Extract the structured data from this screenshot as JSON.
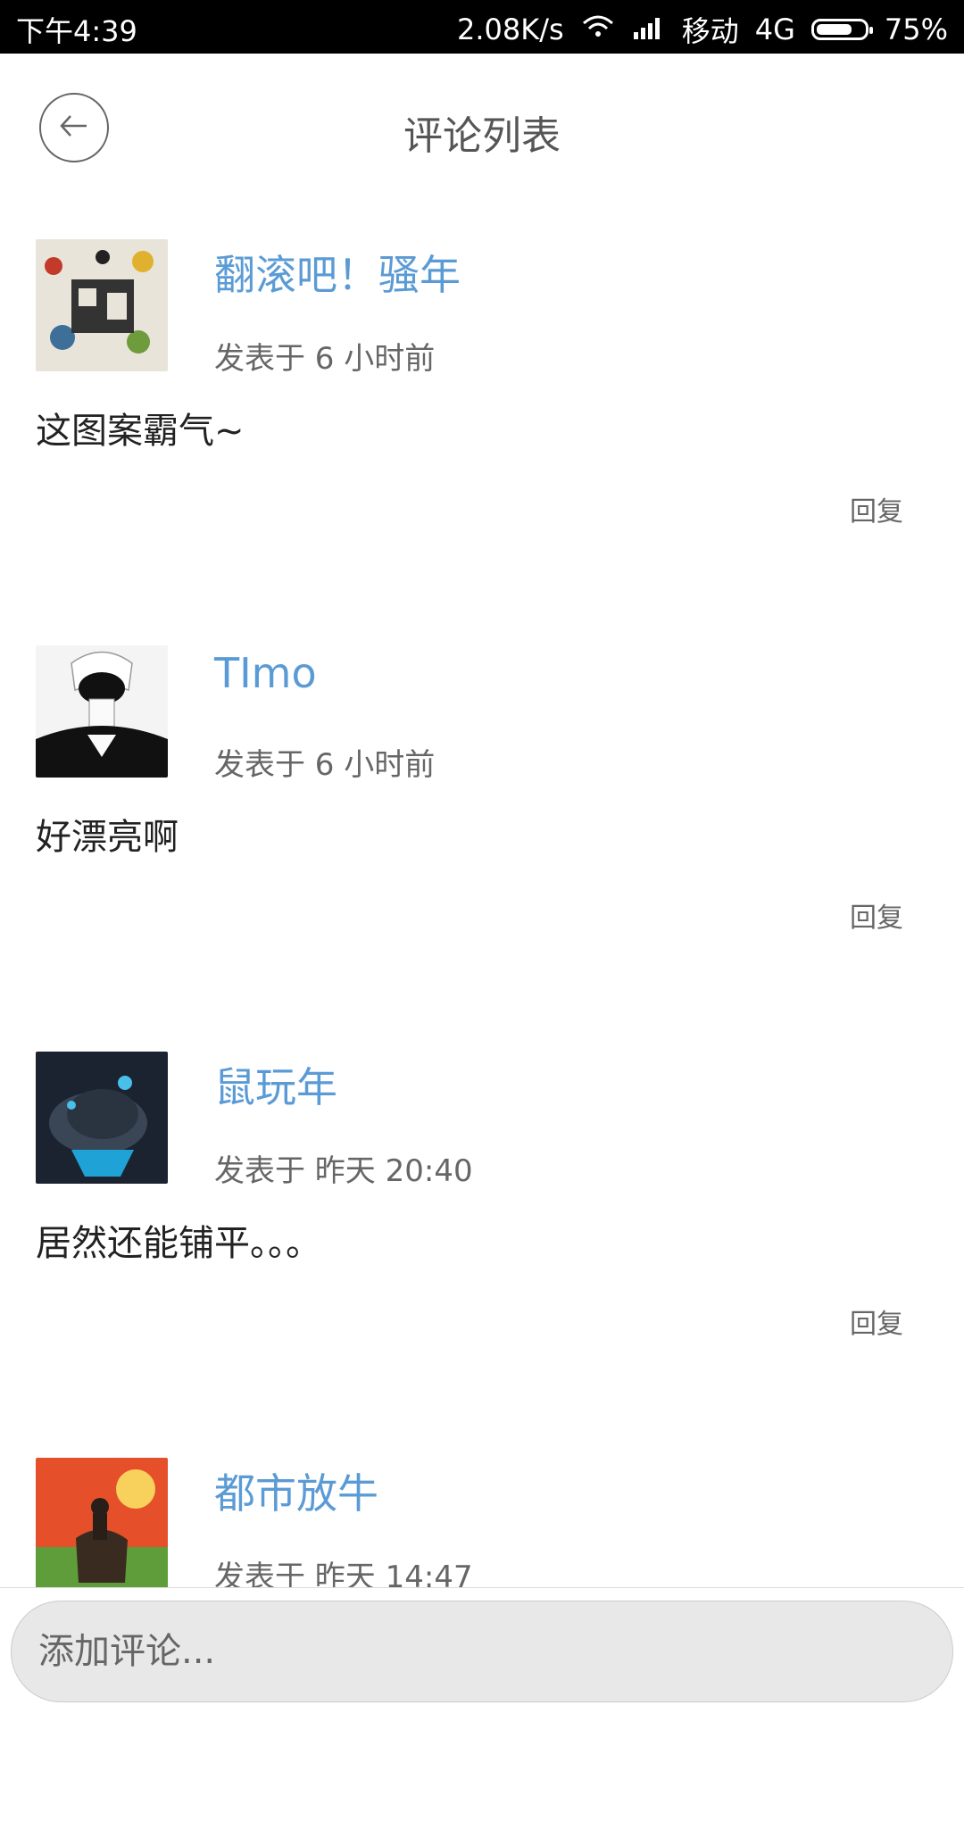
{
  "status_bar": {
    "time": "下午4:39",
    "speed": "2.08K/s",
    "carrier": "移动",
    "network": "4G",
    "battery": "75%",
    "battery_level": 0.75
  },
  "header": {
    "title": "评论列表"
  },
  "comments": [
    {
      "name": "翻滚吧！骚年",
      "meta": "发表于 6 小时前",
      "content": "这图案霸气~",
      "reply": "回复"
    },
    {
      "name": "TImo",
      "meta": "发表于 6 小时前",
      "content": "好漂亮啊",
      "reply": "回复"
    },
    {
      "name": "鼠玩年",
      "meta": "发表于 昨天 20:40",
      "content": "居然还能铺平。。。",
      "reply": "回复"
    },
    {
      "name": "都市放牛",
      "meta": "发表于 昨天 14:47",
      "content": "",
      "reply": ""
    }
  ],
  "input": {
    "placeholder": "添加评论..."
  },
  "colors": {
    "username": "#5b9bd5",
    "statusbar": "#000000",
    "input_bg": "#e8e8e8"
  }
}
